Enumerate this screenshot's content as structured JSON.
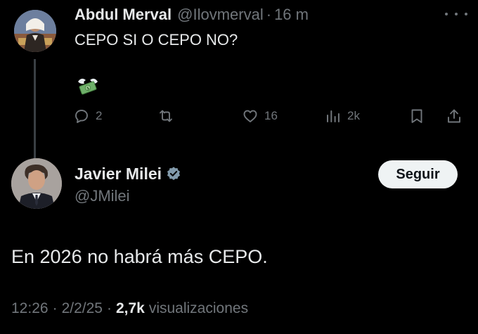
{
  "reply": {
    "author_name": "Abdul Merval",
    "handle": "@Ilovmerval",
    "dot": "·",
    "time": "16 m",
    "text": "CEPO SI O CEPO NO?",
    "attachment_icon": "money-with-wings-icon",
    "actions": {
      "replies": "2",
      "reposts": "",
      "likes": "16",
      "views": "2k"
    }
  },
  "tweet": {
    "author_name": "Javier Milei",
    "handle": "@JMilei",
    "verified": true,
    "follow_label": "Seguir",
    "text": "En 2026 no habrá más CEPO.",
    "time": "12:26",
    "date": "2/2/25",
    "dot": "·",
    "views_count": "2,7k",
    "views_label": "visualizaciones"
  },
  "colors": {
    "background": "#000000",
    "text_primary": "#e7e9ea",
    "text_secondary": "#71767b",
    "verified_badge": "#829aab",
    "follow_button_bg": "#eff3f4"
  }
}
